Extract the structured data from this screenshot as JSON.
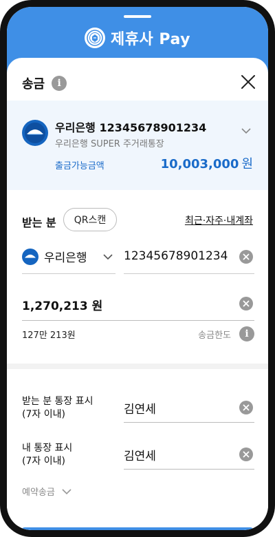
{
  "header": {
    "brand_title": "제휴사 Pay",
    "logo_icon": "university-seal-icon",
    "background": "#3f8fe6"
  },
  "sheet": {
    "title": "송금",
    "title_info_icon": "i"
  },
  "from_account": {
    "bank_and_number": "우리은행 12345678901234",
    "account_type": "우리은행 SUPER 주거래통장",
    "available_label": "출금가능금액",
    "available_amount": "10,003,000",
    "currency_unit": "원",
    "accent": "#1a6bc9"
  },
  "receiver": {
    "label": "받는 분",
    "qr_button": "QR스캔",
    "recent_link": "최근·자주·내계좌",
    "bank_name": "우리은행",
    "account_number": "12345678901234"
  },
  "amount": {
    "value": "1,270,213 원",
    "in_words": "127만 213원",
    "limit_label": "송금한도",
    "limit_info_icon": "i"
  },
  "memo": {
    "receiver_display_label_line1": "받는 분 통장 표시",
    "receiver_display_label_line2": "(7자 이내)",
    "receiver_display_value": "김연세",
    "my_display_label_line1": "내 통장 표시",
    "my_display_label_line2": "(7자 이내)",
    "my_display_value": "김연세"
  },
  "reserve": {
    "label": "예약송금"
  }
}
